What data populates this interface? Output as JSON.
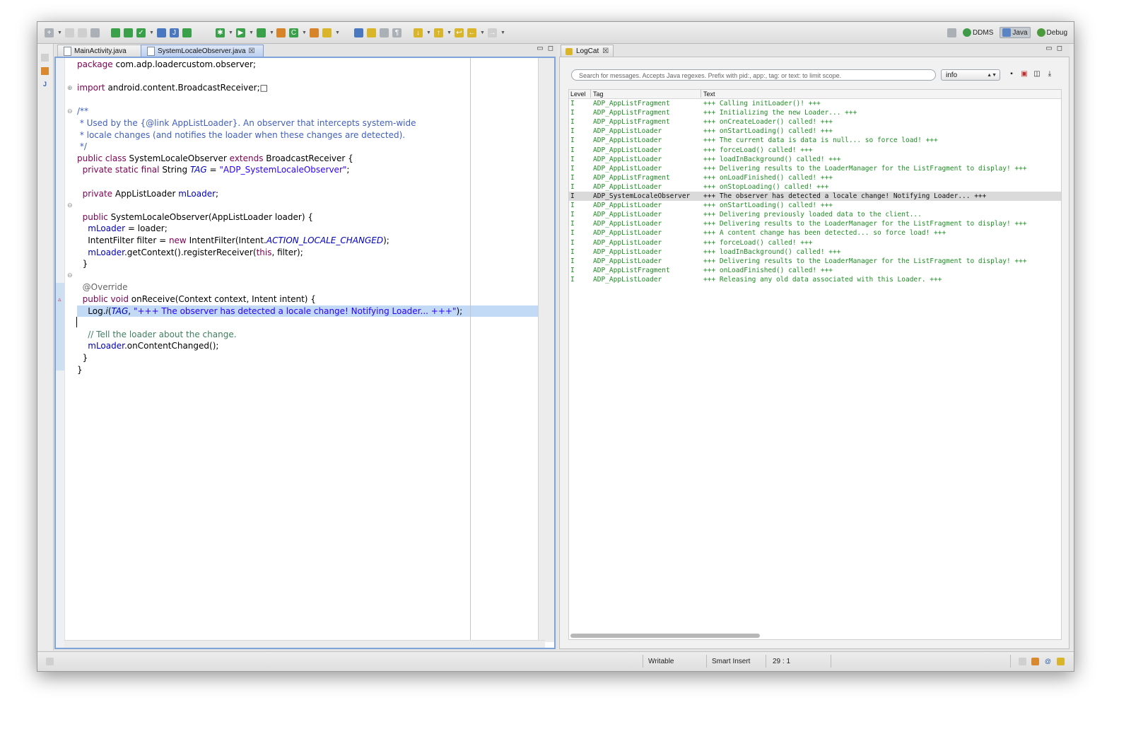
{
  "perspectives": {
    "ddms": "DDMS",
    "java": "Java",
    "debug": "Debug"
  },
  "editor": {
    "tabs": [
      {
        "label": "MainActivity.java",
        "active": false
      },
      {
        "label": "SystemLocaleObserver.java",
        "active": true
      }
    ]
  },
  "code": [
    {
      "html": "<span class='kw'>package</span> com.adp.loadercustom.observer;"
    },
    {
      "html": ""
    },
    {
      "html": "<span class='kw'>import</span> android.content.BroadcastReceiver;&#9633;"
    },
    {
      "html": ""
    },
    {
      "html": "<span class='jd'>/**</span>"
    },
    {
      "html": "<span class='jd'> * Used by the {@link AppListLoader}. An observer that intercepts system-wide</span>"
    },
    {
      "html": "<span class='jd'> * locale changes (and notifies the loader when these changes are detected).</span>"
    },
    {
      "html": "<span class='jd'> */</span>"
    },
    {
      "html": "<span class='kw'>public class</span> SystemLocaleObserver <span class='kw'>extends</span> BroadcastReceiver {"
    },
    {
      "html": "  <span class='kw'>private static final</span> String <span class='st-it'>TAG</span> = <span class='str'>\"ADP_SystemLocaleObserver\"</span>;"
    },
    {
      "html": ""
    },
    {
      "html": "  <span class='kw'>private</span> AppListLoader <span class='fld'>mLoader</span>;"
    },
    {
      "html": ""
    },
    {
      "html": "  <span class='kw'>public</span> SystemLocaleObserver(AppListLoader loader) {"
    },
    {
      "html": "    <span class='fld'>mLoader</span> = loader;"
    },
    {
      "html": "    IntentFilter filter = <span class='kw'>new</span> IntentFilter(Intent.<span class='st-it'>ACTION_LOCALE_CHANGED</span>);"
    },
    {
      "html": "    <span class='fld'>mLoader</span>.getContext().registerReceiver(<span class='kw'>this</span>, filter);"
    },
    {
      "html": "  }"
    },
    {
      "html": ""
    },
    {
      "html": "  <span class='ann'>@Override</span>"
    },
    {
      "html": "  <span class='kw'>public void</span> onReceive(Context context, Intent intent) {"
    },
    {
      "html": "    Log.<i>i</i>(<span class='st-it'>TAG</span>, <span class='str'>\"+++ The observer has detected a locale change! Notifying Loader... +++\"</span>);",
      "highlight": true
    },
    {
      "html": ""
    },
    {
      "html": "    <span class='cm'>// Tell the loader about the change.</span>"
    },
    {
      "html": "    <span class='fld'>mLoader</span>.onContentChanged();"
    },
    {
      "html": "  }"
    },
    {
      "html": "}"
    }
  ],
  "logcat": {
    "tab_label": "LogCat",
    "search_placeholder": "Search for messages. Accepts Java regexes. Prefix with pid:, app:, tag: or text: to limit scope.",
    "level_value": "info",
    "columns": {
      "level": "Level",
      "tag": "Tag",
      "text": "Text"
    },
    "rows": [
      {
        "level": "I",
        "tag": "ADP_AppListFragment",
        "text": "+++ Calling initLoader()! +++"
      },
      {
        "level": "I",
        "tag": "ADP_AppListFragment",
        "text": "+++ Initializing the new Loader... +++"
      },
      {
        "level": "I",
        "tag": "ADP_AppListFragment",
        "text": "+++ onCreateLoader() called! +++"
      },
      {
        "level": "I",
        "tag": "ADP_AppListLoader",
        "text": "+++ onStartLoading() called! +++"
      },
      {
        "level": "I",
        "tag": "ADP_AppListLoader",
        "text": "+++ The current data is data is null... so force load! +++"
      },
      {
        "level": "I",
        "tag": "ADP_AppListLoader",
        "text": "+++ forceLoad() called! +++"
      },
      {
        "level": "I",
        "tag": "ADP_AppListLoader",
        "text": "+++ loadInBackground() called! +++"
      },
      {
        "level": "I",
        "tag": "ADP_AppListLoader",
        "text": "+++ Delivering results to the LoaderManager for the ListFragment to display! +++"
      },
      {
        "level": "I",
        "tag": "ADP_AppListFragment",
        "text": "+++ onLoadFinished() called! +++"
      },
      {
        "level": "I",
        "tag": "ADP_AppListLoader",
        "text": "+++ onStopLoading() called! +++"
      },
      {
        "level": "I",
        "tag": "ADP_SystemLocaleObserver",
        "text": "+++ The observer has detected a locale change! Notifying Loader... +++",
        "selected": true
      },
      {
        "level": "I",
        "tag": "ADP_AppListLoader",
        "text": "+++ onStartLoading() called! +++"
      },
      {
        "level": "I",
        "tag": "ADP_AppListLoader",
        "text": "+++ Delivering previously loaded data to the client..."
      },
      {
        "level": "I",
        "tag": "ADP_AppListLoader",
        "text": "+++ Delivering results to the LoaderManager for the ListFragment to display! +++"
      },
      {
        "level": "I",
        "tag": "ADP_AppListLoader",
        "text": "+++ A content change has been detected... so force load! +++"
      },
      {
        "level": "I",
        "tag": "ADP_AppListLoader",
        "text": "+++ forceLoad() called! +++"
      },
      {
        "level": "I",
        "tag": "ADP_AppListLoader",
        "text": "+++ loadInBackground() called! +++"
      },
      {
        "level": "I",
        "tag": "ADP_AppListLoader",
        "text": "+++ Delivering results to the LoaderManager for the ListFragment to display! +++"
      },
      {
        "level": "I",
        "tag": "ADP_AppListFragment",
        "text": "+++ onLoadFinished() called! +++"
      },
      {
        "level": "I",
        "tag": "ADP_AppListLoader",
        "text": "+++ Releasing any old data associated with this Loader. +++"
      }
    ]
  },
  "status": {
    "writable": "Writable",
    "insert_mode": "Smart Insert",
    "position": "29 : 1"
  }
}
